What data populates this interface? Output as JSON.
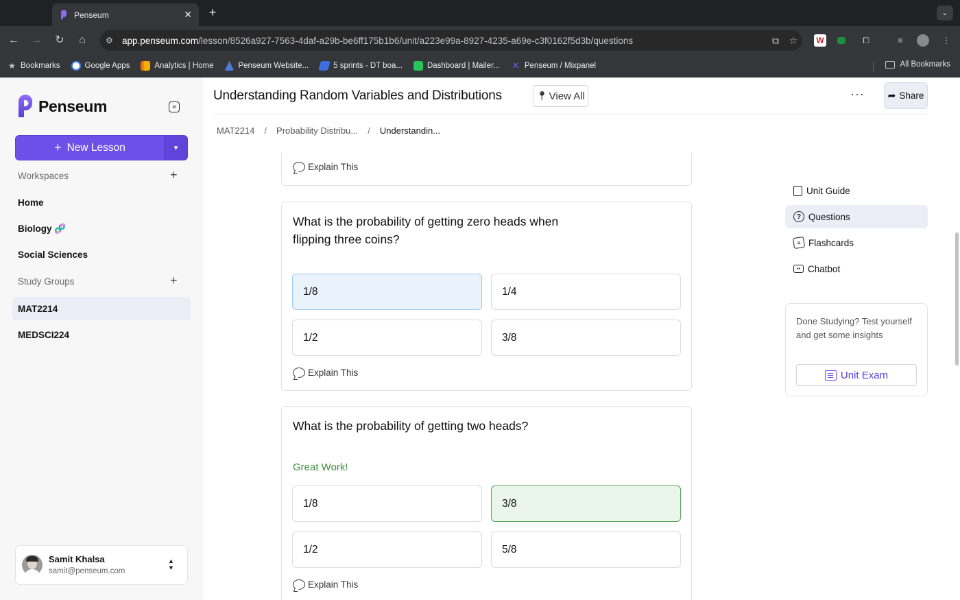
{
  "browser": {
    "tab_title": "Penseum",
    "url_host": "app.penseum.com",
    "url_path": "/lesson/8526a927-7563-4daf-a29b-be6ff175b1b6/unit/a223e99a-8927-4235-a69e-c3f0162f5d3b/questions",
    "bookmarks": [
      {
        "label": "Bookmarks",
        "color": "#c4c7c5"
      },
      {
        "label": "Google Apps",
        "color": "#4285f4"
      },
      {
        "label": "Analytics | Home",
        "color": "#f9ab00"
      },
      {
        "label": "Penseum Website...",
        "color": "#4a7bd6"
      },
      {
        "label": "5 sprints - DT boa...",
        "color": "#3b6fe0"
      },
      {
        "label": "Dashboard | Mailer...",
        "color": "#27c35c"
      },
      {
        "label": "Penseum / Mixpanel",
        "color": "#7856ff"
      }
    ],
    "all_bookmarks": "All Bookmarks"
  },
  "sidebar": {
    "brand": "Penseum",
    "new_lesson": "New Lesson",
    "workspaces_label": "Workspaces",
    "workspaces": [
      "Home",
      "Biology 🧬",
      "Social Sciences"
    ],
    "study_groups_label": "Study Groups",
    "study_groups": [
      "MAT2214",
      "MEDSCI224"
    ],
    "active_group": "MAT2214",
    "user": {
      "name": "Samit Khalsa",
      "email": "samit@penseum.com"
    }
  },
  "header": {
    "title": "Understanding Random Variables and Distributions",
    "view_all": "View All",
    "share": "Share"
  },
  "breadcrumb": [
    "MAT2214",
    "Probability Distribu...",
    "Understandin..."
  ],
  "questions": [
    {
      "explain": "Explain This"
    },
    {
      "text": "What is the probability of getting zero heads when flipping three coins?",
      "options": [
        "1/8",
        "1/4",
        "1/2",
        "3/8"
      ],
      "selected": "1/8",
      "explain": "Explain This"
    },
    {
      "text": "What is the probability of getting two heads?",
      "feedback": "Great Work!",
      "options": [
        "1/8",
        "3/8",
        "1/2",
        "5/8"
      ],
      "selected": "3/8",
      "explain": "Explain This"
    }
  ],
  "right_nav": [
    "Unit Guide",
    "Questions",
    "Flashcards",
    "Chatbot"
  ],
  "right_nav_active": "Questions",
  "exam_card": {
    "text": "Done Studying? Test yourself and get some insights",
    "button": "Unit Exam"
  },
  "colors": {
    "brand": "#6d50e8",
    "correct": "#3f8f3f",
    "selected": "#eaf3fb"
  }
}
